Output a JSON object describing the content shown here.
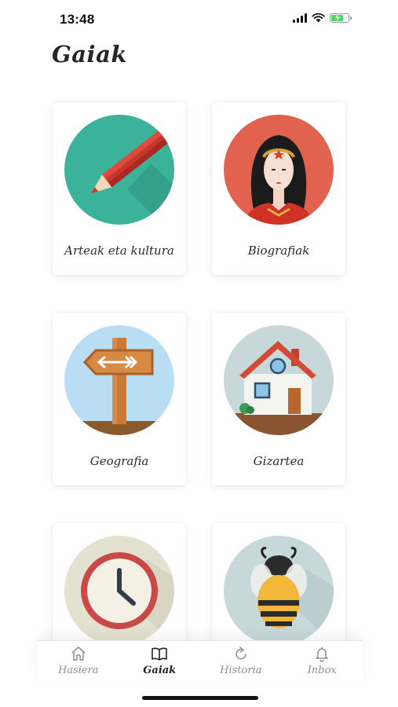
{
  "status_bar": {
    "time": "13:48",
    "icons": [
      "signal-icon",
      "wifi-icon",
      "battery-charging-icon"
    ],
    "battery_level": 0.7
  },
  "page": {
    "title": "Gaiak"
  },
  "topics": [
    {
      "label": "Arteak eta kultura",
      "icon": "pencil-icon"
    },
    {
      "label": "Biografiak",
      "icon": "wonder-woman-icon"
    },
    {
      "label": "Geografia",
      "icon": "signpost-icon"
    },
    {
      "label": "Gizartea",
      "icon": "house-icon"
    },
    {
      "label": "",
      "icon": "clock-icon"
    },
    {
      "label": "",
      "icon": "bee-icon"
    }
  ],
  "tab_bar": {
    "active": "Gaiak",
    "tabs": [
      {
        "label": "Hasiera",
        "icon": "home-icon"
      },
      {
        "label": "Gaiak",
        "icon": "book-icon"
      },
      {
        "label": "Historia",
        "icon": "refresh-icon"
      },
      {
        "label": "Inbox",
        "icon": "bell-icon"
      }
    ]
  },
  "colors": {
    "pencil_bg": "#3bb39b",
    "portrait_bg": "#e0624f",
    "sky_bg": "#b9ddf3",
    "house_bg": "#c8d8da",
    "clock_bg": "#e3e2d0",
    "bee_bg": "#c6d8da"
  }
}
